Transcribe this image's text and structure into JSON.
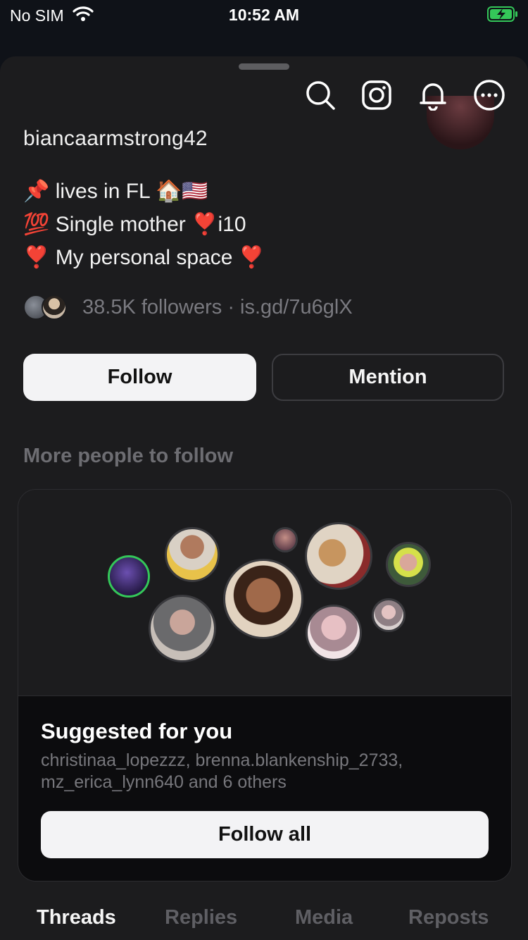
{
  "status_bar": {
    "carrier": "No SIM",
    "time": "10:52 AM"
  },
  "profile": {
    "username": "biancaarmstrong42",
    "bio": [
      "📌 lives in FL 🏠🇺🇸",
      "💯 Single mother ❣️i10",
      "❣️ My personal space ❣️"
    ],
    "followers_text": "38.5K followers · is.gd/7u6glX"
  },
  "actions": {
    "follow_label": "Follow",
    "mention_label": "Mention"
  },
  "more_people_heading": "More people to follow",
  "suggested": {
    "title": "Suggested for you",
    "names": "christinaa_lopezzz, brenna.blankenship_2733, mz_erica_lynn640 and 6 others",
    "follow_all_label": "Follow all"
  },
  "tabs": [
    {
      "label": "Threads",
      "active": true
    },
    {
      "label": "Replies",
      "active": false
    },
    {
      "label": "Media",
      "active": false
    },
    {
      "label": "Reposts",
      "active": false
    }
  ],
  "icons": [
    "search-icon",
    "instagram-icon",
    "bell-icon",
    "more-icon"
  ],
  "colors": {
    "accent_green": "#34c759",
    "sheet_bg": "#1c1c1e",
    "page_bg": "#0f1218"
  }
}
